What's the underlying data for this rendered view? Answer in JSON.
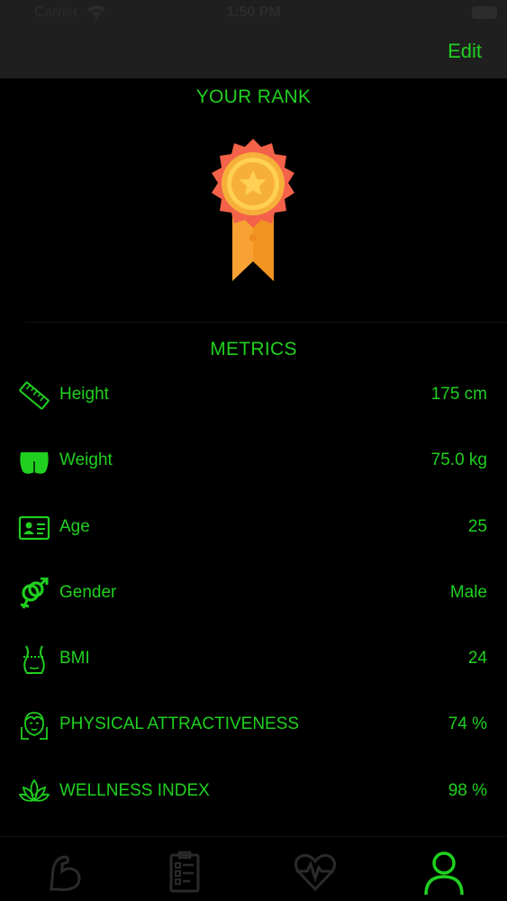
{
  "status_bar": {
    "carrier": "Carrier",
    "time": "1:50 PM"
  },
  "nav": {
    "edit_label": "Edit"
  },
  "rank": {
    "title": "YOUR RANK",
    "badge_icon": "medal-icon"
  },
  "metrics": {
    "title": "METRICS",
    "items": [
      {
        "icon": "ruler-icon",
        "label": "Height",
        "value": "175 cm"
      },
      {
        "icon": "body-weight-icon",
        "label": "Weight",
        "value": "75.0 kg"
      },
      {
        "icon": "id-card-icon",
        "label": "Age",
        "value": "25"
      },
      {
        "icon": "gender-icon",
        "label": "Gender",
        "value": "Male"
      },
      {
        "icon": "waist-icon",
        "label": "BMI",
        "value": "24"
      },
      {
        "icon": "face-icon",
        "label": "PHYSICAL ATTRACTIVENESS",
        "value": "74 %"
      },
      {
        "icon": "lotus-icon",
        "label": "WELLNESS INDEX",
        "value": "98 %"
      }
    ]
  },
  "tabs": [
    {
      "icon": "muscle-icon",
      "active": false
    },
    {
      "icon": "clipboard-icon",
      "active": false
    },
    {
      "icon": "heart-pulse-icon",
      "active": false
    },
    {
      "icon": "profile-icon",
      "active": true
    }
  ],
  "colors": {
    "accent": "#20d020",
    "inactive_tab": "#2a2a2a",
    "bar_background": "#1f1f1f",
    "background": "#000000"
  }
}
